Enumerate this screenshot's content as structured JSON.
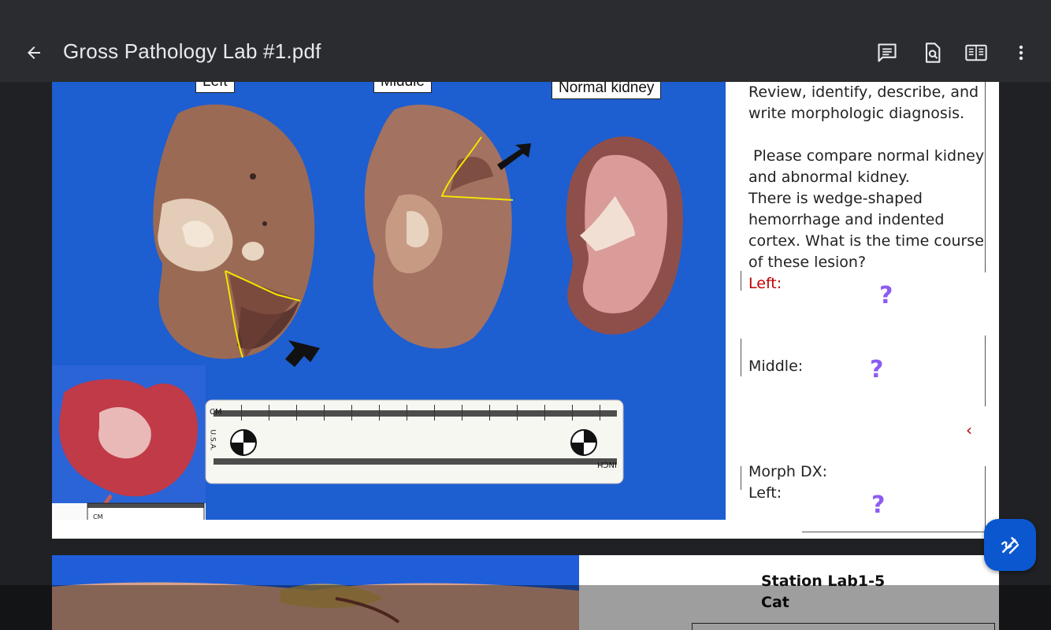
{
  "app_bar": {
    "title": "Gross Pathology Lab #1.pdf",
    "back_icon": "arrow-left-icon",
    "actions": [
      {
        "name": "comments-icon"
      },
      {
        "name": "find-in-document-icon"
      },
      {
        "name": "reading-mode-icon"
      },
      {
        "name": "more-options-icon"
      }
    ]
  },
  "page1": {
    "photo_labels": {
      "left": "Left",
      "middle": "Middle",
      "normal": "Normal kidney"
    },
    "question_text": [
      "Review, identify, describe, and",
      "write morphologic diagnosis.",
      "",
      " Please compare normal kidney",
      "and abnormal kidney.",
      "There is wedge-shaped",
      "hemorrhage and indented",
      "cortex. What is the time course",
      "of these lesion?"
    ],
    "left_label": "Left:",
    "middle_label": "Middle:",
    "morph_dx_label": "Morph DX:",
    "morph_left_label": "Left:",
    "question_mark": "?",
    "chevron": "‹",
    "ruler_units": {
      "cm": "CM",
      "inch": "INCH",
      "usa": "U.S.A."
    }
  },
  "page2": {
    "station_title": "Station Lab1-5",
    "species": "Cat"
  },
  "fab": {
    "icon": "annotate-pen-icon"
  },
  "colors": {
    "app_bar": "#2b2c2f",
    "background": "#202124",
    "photo_blue": "#1f5ed8",
    "red_text": "#c00000",
    "question_purple": "#8c5cf0",
    "fab": "#0b57d0"
  }
}
